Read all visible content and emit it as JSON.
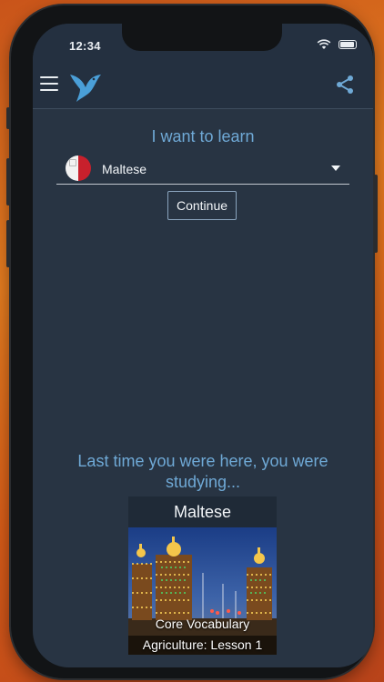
{
  "status_bar": {
    "time": "12:34"
  },
  "app_bar": {
    "menu_icon": "hamburger-menu-icon",
    "logo_icon": "bird-logo-icon",
    "share_icon": "share-icon"
  },
  "learn": {
    "title": "I want to learn",
    "selected_language": "Maltese",
    "flag_icon": "malta-flag-icon",
    "continue_label": "Continue"
  },
  "last_session": {
    "message": "Last time you were here, you were studying...",
    "card": {
      "language": "Maltese",
      "course": "Core Vocabulary",
      "lesson": "Agriculture: Lesson 1"
    }
  },
  "colors": {
    "accent": "#6fa9d6",
    "background": "#283443",
    "text": "#f2f5f8",
    "flag_red": "#c8202c"
  }
}
